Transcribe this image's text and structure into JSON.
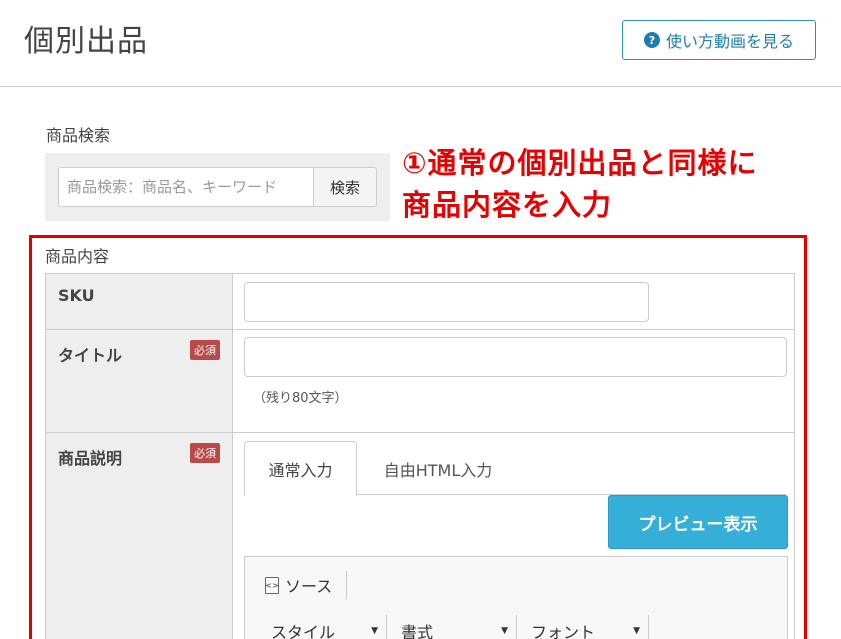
{
  "header": {
    "title": "個別出品",
    "help_button_label": "使い方動画を見る",
    "help_icon": "question-circle-icon"
  },
  "search": {
    "label": "商品検索",
    "placeholder": "商品検索：商品名、キーワード",
    "button_label": "検索"
  },
  "annotation": {
    "line1": "①通常の個別出品と同様に",
    "line2": "商品内容を入力",
    "color": "#e60000"
  },
  "section": {
    "label": "商品内容"
  },
  "form": {
    "sku_label": "SKU",
    "title_label": "タイトル",
    "title_required": "必須",
    "title_remaining": "（残り80文字）",
    "description_label": "商品説明",
    "description_required": "必須"
  },
  "editor": {
    "tabs": [
      {
        "label": "通常入力",
        "active": true
      },
      {
        "label": "自由HTML入力",
        "active": false
      }
    ],
    "preview_button_label": "プレビュー表示",
    "source_label": "ソース",
    "source_icon": "source-code-icon",
    "style_combo": "スタイル",
    "format_combo": "書式",
    "font_combo": "フォント"
  },
  "colors": {
    "accent": "#1f7fab",
    "preview_button": "#35aed8",
    "required_badge": "#b94a48",
    "annotation_frame": "#e60000"
  }
}
